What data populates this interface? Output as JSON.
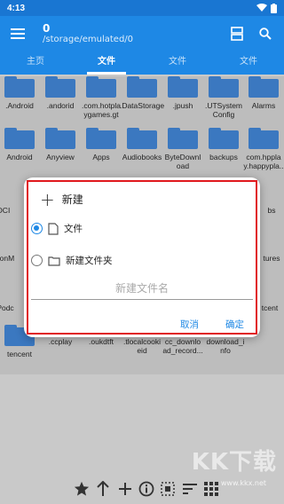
{
  "status": {
    "time": "4:13"
  },
  "appbar": {
    "title": "0",
    "path": "/storage/emulated/0"
  },
  "tabs": [
    "主页",
    "文件",
    "文件",
    "文件"
  ],
  "files": [
    ".Android",
    ".andorid",
    ".com.hotpla\nygames.gt",
    ".DataStorage",
    ".jpush",
    ".UTSystem\nConfig",
    "Alarms",
    "Android",
    "Anyview",
    "Apps",
    "Audiobooks",
    "ByteDownl\noad",
    "backups",
    "com.hppla\ny.happypla..",
    "tencent",
    ".ccplay",
    ".oukdtft",
    ".tlocalcooki\neid",
    "cc_downlo\nad_record...",
    "download_i\nnfo"
  ],
  "edge_labels": {
    "left": [
      "DCI",
      "lionM",
      "Podc"
    ],
    "right": [
      "bs",
      "tures",
      "tcent"
    ]
  },
  "dialog": {
    "title": "新建",
    "option_file": "文件",
    "option_folder": "新建文件夹",
    "placeholder": "新建文件名",
    "cancel": "取消",
    "ok": "确定"
  },
  "watermark": {
    "brand": "KK下载",
    "url": "www.kkx.net"
  },
  "colors": {
    "primary": "#1e88e5",
    "outline": "#e0191d"
  }
}
